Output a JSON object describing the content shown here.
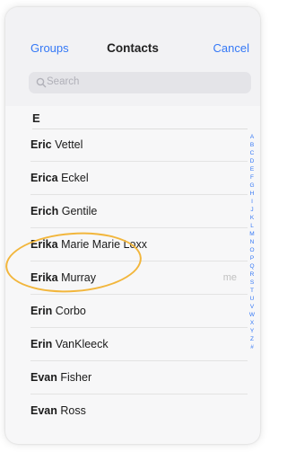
{
  "navbar": {
    "left_label": "Groups",
    "title": "Contacts",
    "right_label": "Cancel"
  },
  "search": {
    "placeholder": "Search"
  },
  "section": {
    "letter": "E"
  },
  "contacts": [
    {
      "first": "Eric",
      "last": "Vettel"
    },
    {
      "first": "Erica",
      "last": "Eckel"
    },
    {
      "first": "Erich",
      "last": "Gentile"
    },
    {
      "first": "Erika",
      "last": "Marie Marie Loxx"
    },
    {
      "first": "Erika",
      "last": "Murray",
      "me": "me"
    },
    {
      "first": "Erin",
      "last": "Corbo"
    },
    {
      "first": "Erin",
      "last": "VanKleeck"
    },
    {
      "first": "Evan",
      "last": "Fisher"
    },
    {
      "first": "Evan",
      "last": "Ross"
    }
  ],
  "index_letters": [
    "A",
    "B",
    "C",
    "D",
    "E",
    "F",
    "G",
    "H",
    "I",
    "J",
    "K",
    "L",
    "M",
    "N",
    "O",
    "P",
    "Q",
    "R",
    "S",
    "T",
    "U",
    "V",
    "W",
    "X",
    "Y",
    "Z",
    "#"
  ],
  "colors": {
    "accent": "#3478f6",
    "highlight": "#f2b63c"
  },
  "icons": {
    "search": "search-icon"
  }
}
